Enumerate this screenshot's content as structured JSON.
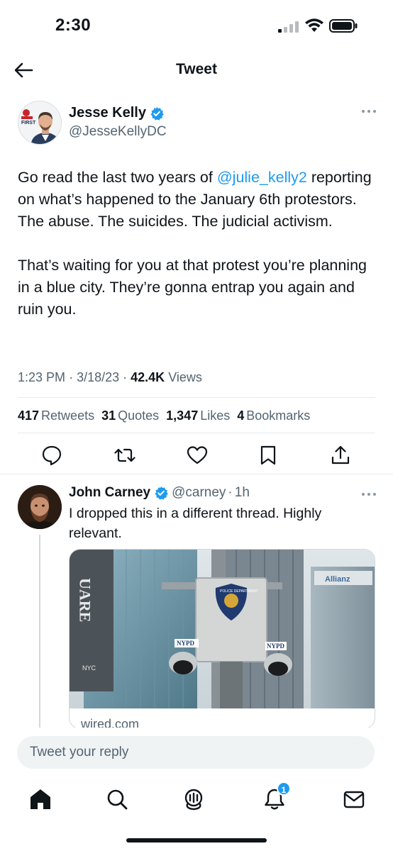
{
  "status_bar": {
    "time": "2:30"
  },
  "header": {
    "title": "Tweet"
  },
  "main_tweet": {
    "author_name": "Jesse Kelly",
    "author_handle": "@JesseKellyDC",
    "avatar_logo_text": "FIRST",
    "text_before_mention": "Go read the last two years of ",
    "mention": "@julie_kelly2",
    "text_after_mention": " reporting on what’s happened to the January 6th protestors. The abuse. The suicides. The judicial activism.",
    "paragraph2": "That’s waiting for you at that protest you’re planning in a blue city. They’re gonna entrap you again and ruin you.",
    "time": "1:23 PM",
    "date": "3/18/23",
    "views_count": "42.4K",
    "views_label": "Views",
    "stats": {
      "retweets_count": "417",
      "retweets_label": "Retweets",
      "quotes_count": "31",
      "quotes_label": "Quotes",
      "likes_count": "1,347",
      "likes_label": "Likes",
      "bookmarks_count": "4",
      "bookmarks_label": "Bookmarks"
    }
  },
  "reply": {
    "author_name": "John Carney",
    "author_handle": "@carney",
    "time_ago": "1h",
    "text": "I dropped this in a different thread. Highly relevant.",
    "card": {
      "domain": "wired.com",
      "image_signs": {
        "square": "UARE",
        "nyc": "NYC",
        "police": "POLICE DEPARTMENT",
        "nypd_left": "NYPD",
        "nypd_right": "NYPD",
        "allianz": "Allianz"
      }
    }
  },
  "composer": {
    "placeholder": "Tweet your reply"
  },
  "bottom_nav": {
    "notifications_badge": "1"
  },
  "colors": {
    "accent": "#1d9bf0",
    "text_primary": "#0f1419",
    "text_secondary": "#536471",
    "divider": "#e6e9ec"
  }
}
